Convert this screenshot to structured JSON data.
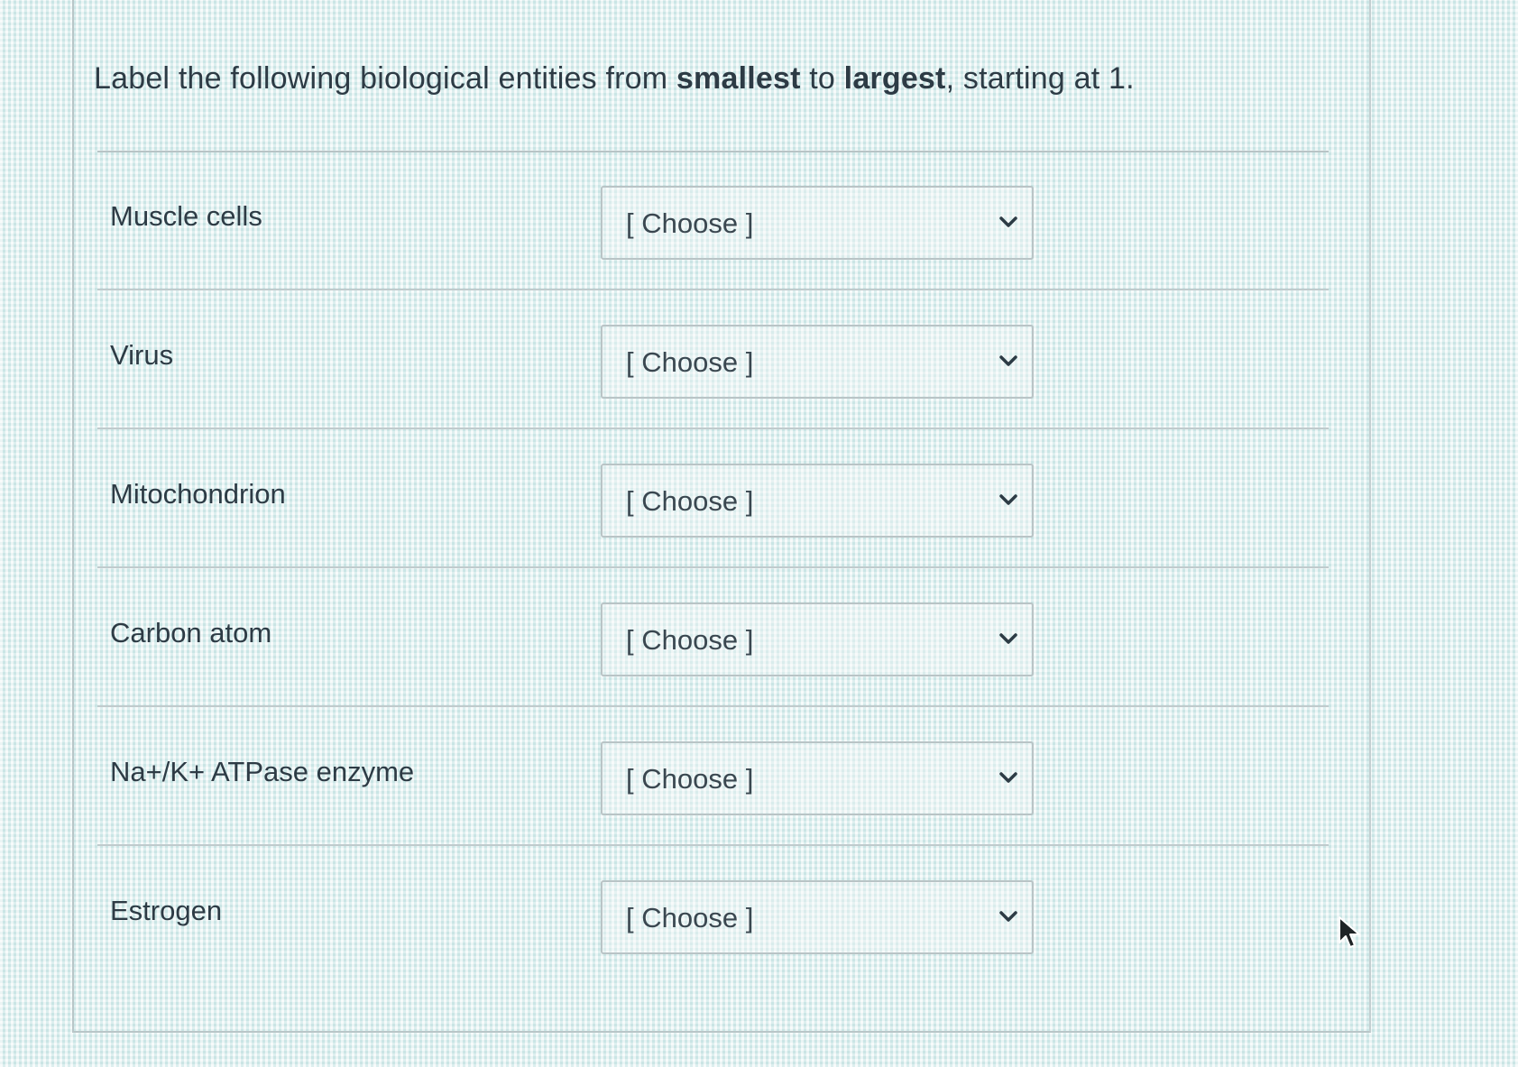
{
  "question": {
    "prefix": "Label the following biological entities from ",
    "smallest": "smallest",
    "middle": " to ",
    "largest": "largest",
    "suffix": ", starting at 1."
  },
  "rows": [
    {
      "label": "Muscle cells",
      "value": "[ Choose ]",
      "icon": "chevron-down-icon"
    },
    {
      "label": "Virus",
      "value": "[ Choose ]",
      "icon": "chevron-down-icon"
    },
    {
      "label": "Mitochondrion",
      "value": "[ Choose ]",
      "icon": "chevron-down-icon"
    },
    {
      "label": "Carbon atom",
      "value": "[ Choose ]",
      "icon": "chevron-down-icon"
    },
    {
      "label": "Na+/K+ ATPase enzyme",
      "value": "[ Choose ]",
      "icon": "chevron-down-icon"
    },
    {
      "label": "Estrogen",
      "value": "[ Choose ]",
      "icon": "chevron-down-icon"
    }
  ],
  "colors": {
    "text": "#2d3b45",
    "border": "#b9c4c6"
  }
}
